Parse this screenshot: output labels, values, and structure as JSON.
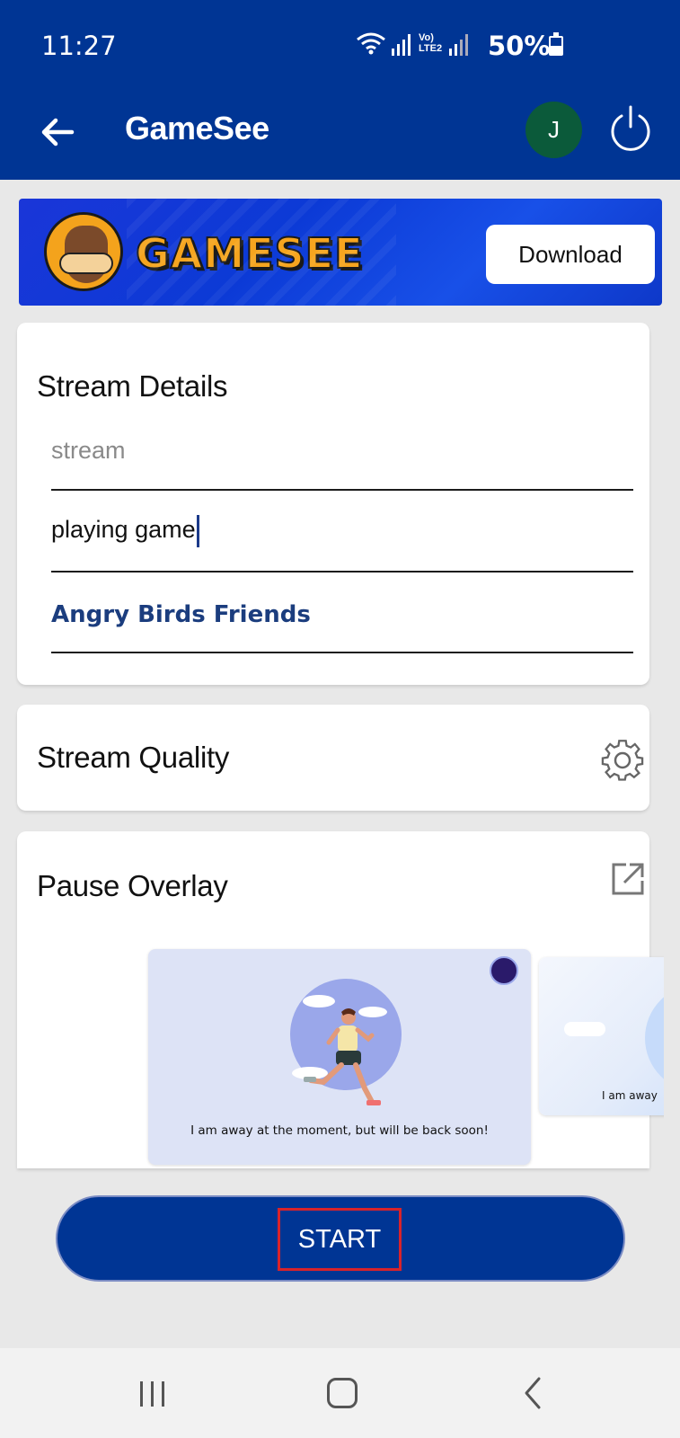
{
  "status_bar": {
    "time": "11:27",
    "network_label": "Vo) LTE2",
    "battery": "50%",
    "battery_level": 0.5
  },
  "app_bar": {
    "title": "GameSee",
    "avatar_initial": "J",
    "back_icon": "arrow-left-icon",
    "power_icon": "power-icon"
  },
  "banner": {
    "logo_text": "GAMESEE",
    "download_label": "Download"
  },
  "stream_details": {
    "title": "Stream Details",
    "field1_placeholder": "stream",
    "field2_value": "playing game",
    "game_name": "Angry Birds Friends"
  },
  "stream_quality": {
    "title": "Stream Quality",
    "icon": "gear-icon"
  },
  "pause_overlay": {
    "title": "Pause Overlay",
    "icon": "external-link-icon",
    "items": [
      {
        "caption": "I am away at the moment, but will be back soon!"
      },
      {
        "caption": "I am away"
      }
    ]
  },
  "start_button": {
    "label": "START"
  },
  "colors": {
    "primary": "#003594",
    "highlight": "#d8232a",
    "link": "#1b3d7e",
    "avatar_bg": "#0b5a3a"
  }
}
